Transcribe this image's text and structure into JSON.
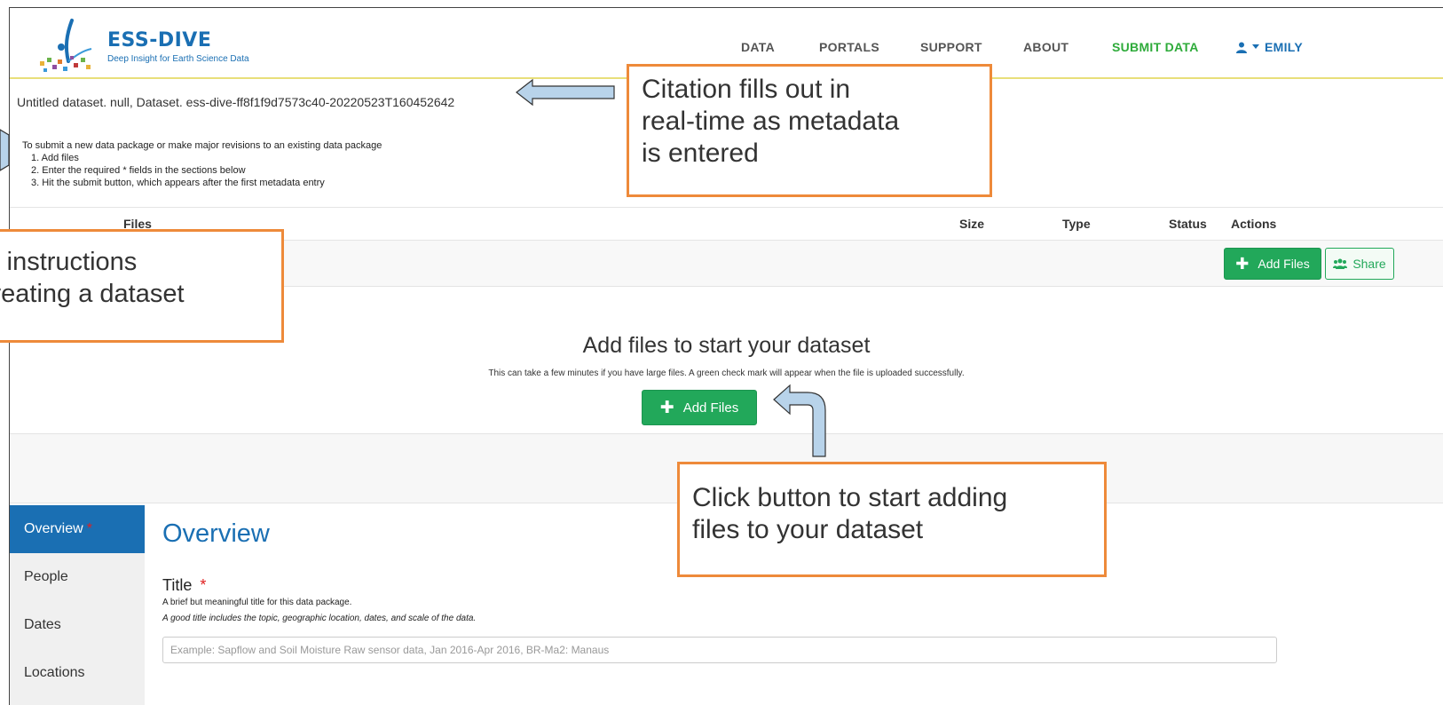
{
  "header": {
    "logo_title": "ESS-DIVE",
    "logo_subtitle": "Deep Insight for Earth Science Data",
    "nav": [
      {
        "label": "DATA"
      },
      {
        "label": "PORTALS"
      },
      {
        "label": "SUPPORT"
      },
      {
        "label": "ABOUT"
      },
      {
        "label": "SUBMIT DATA"
      },
      {
        "label": "EMILY"
      }
    ]
  },
  "citation": "Untitled dataset. null, Dataset. ess-dive-ff8f1f9d7573c40-20220523T160452642",
  "instructions": {
    "intro": "To submit a new data package or make major revisions to an existing data package",
    "steps": [
      "1. Add files",
      "2. Enter the required * fields in the sections below",
      "3. Hit the submit button, which appears after the first metadata entry"
    ]
  },
  "files_table": {
    "columns": [
      "Files",
      "Size",
      "Type",
      "Status",
      "Actions"
    ],
    "add_files_label": "Add Files",
    "share_label": "Share"
  },
  "drop_zone": {
    "title": "Add files to start your dataset",
    "subtitle": "This can take a few minutes if you have large files. A green check mark will appear when the file is uploaded successfully.",
    "button_label": "Add Files"
  },
  "editor": {
    "side_nav": [
      {
        "label": "Overview",
        "required": "*"
      },
      {
        "label": "People"
      },
      {
        "label": "Dates"
      },
      {
        "label": "Locations"
      }
    ],
    "section_title": "Overview",
    "title_field": {
      "label": "Title",
      "required": "*",
      "help": "A brief but meaningful title for this data package.",
      "help_italic": "A good title includes the topic, geographic location, dates, and scale of the data.",
      "placeholder": "Example: Sapflow and Soil Moisture Raw sensor data, Jan 2016-Apr 2016, BR-Ma2: Manaus"
    }
  },
  "annotations": {
    "citation_note": [
      "Citation fills out in",
      "real-time as metadata",
      "is entered"
    ],
    "instructions_note": [
      "al instructions",
      "creating a dataset"
    ],
    "button_note": [
      "Click button to start adding",
      "files to your dataset"
    ]
  },
  "colors": {
    "brand_blue": "#1a6fb3",
    "submit_green": "#2eab3a",
    "button_green": "#22a85a",
    "callout_orange": "#ee8a3a",
    "arrow_fill": "#b8d3ea"
  }
}
